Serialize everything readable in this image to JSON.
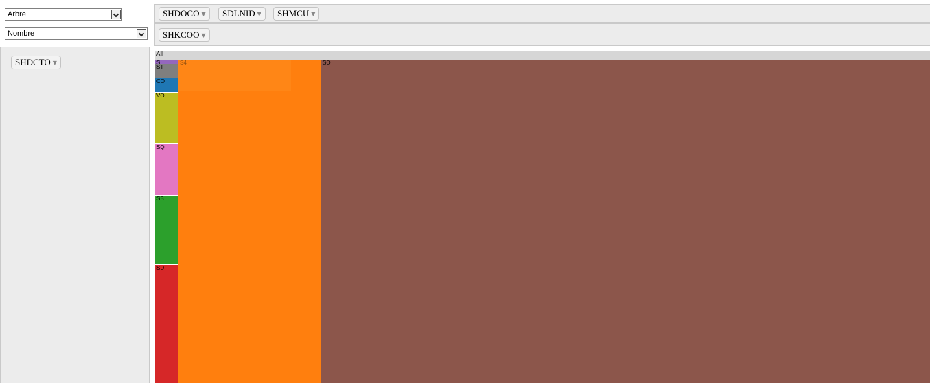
{
  "controls": {
    "renderer_select": {
      "value": "Arbre"
    },
    "aggregator_select": {
      "value": "Nombre"
    }
  },
  "column_fields": [
    "SHDOCO",
    "SDLNID",
    "SHMCU"
  ],
  "row_fields": [
    "SHKCOO"
  ],
  "unused_fields": [
    "SHDCTO"
  ],
  "treemap": {
    "root_label": "All",
    "cells": [
      {
        "label": "SL",
        "color": "#9467bd"
      },
      {
        "label": "ST",
        "color": "#7f7f7f"
      },
      {
        "label": "CO",
        "color": "#1f77b4"
      },
      {
        "label": "VO",
        "color": "#bcbd22"
      },
      {
        "label": "SQ",
        "color": "#e377c2"
      },
      {
        "label": "SB",
        "color": "#2ca02c"
      },
      {
        "label": "SD",
        "color": "#d62728"
      },
      {
        "label": "S4",
        "color": "#ff7f0e"
      },
      {
        "label": "SO",
        "color": "#8c564b"
      }
    ]
  }
}
